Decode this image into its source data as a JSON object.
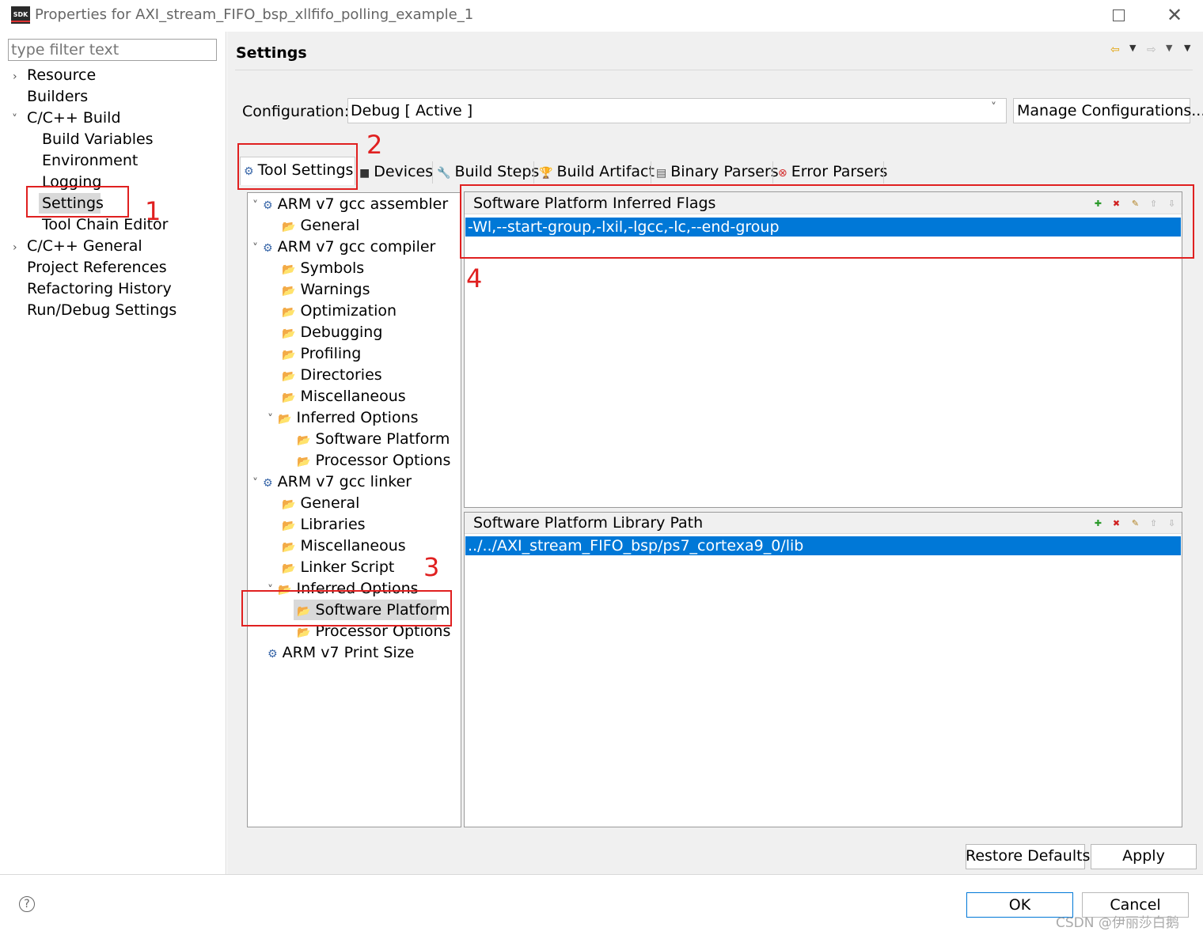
{
  "window": {
    "title": "Properties for AXI_stream_FIFO_bsp_xllfifo_polling_example_1",
    "icon_label": "SDK"
  },
  "filter": {
    "placeholder": "type filter text"
  },
  "left_nav": {
    "items": [
      {
        "label": "Resource",
        "chevron": "›"
      },
      {
        "label": "Builders"
      },
      {
        "label": "C/C++ Build",
        "chevron": "˅"
      },
      {
        "label": "Build Variables"
      },
      {
        "label": "Environment"
      },
      {
        "label": "Logging"
      },
      {
        "label": "Settings"
      },
      {
        "label": "Tool Chain Editor"
      },
      {
        "label": "C/C++ General",
        "chevron": "›"
      },
      {
        "label": "Project References"
      },
      {
        "label": "Refactoring History"
      },
      {
        "label": "Run/Debug Settings"
      }
    ]
  },
  "header": {
    "title": "Settings"
  },
  "config": {
    "label": "Configuration:",
    "value": "Debug  [ Active ]",
    "manage_label": "Manage Configurations..."
  },
  "tabs": [
    {
      "label": "Tool Settings",
      "icon": "gear-icon"
    },
    {
      "label": "Devices",
      "icon": "chip-icon"
    },
    {
      "label": "Build Steps",
      "icon": "wrench-icon"
    },
    {
      "label": "Build Artifact",
      "icon": "trophy-icon"
    },
    {
      "label": "Binary Parsers",
      "icon": "binary-icon"
    },
    {
      "label": "Error Parsers",
      "icon": "error-icon"
    }
  ],
  "tool_tree": [
    {
      "label": "ARM v7 gcc assembler"
    },
    {
      "label": "General"
    },
    {
      "label": "ARM v7 gcc compiler"
    },
    {
      "label": "Symbols"
    },
    {
      "label": "Warnings"
    },
    {
      "label": "Optimization"
    },
    {
      "label": "Debugging"
    },
    {
      "label": "Profiling"
    },
    {
      "label": "Directories"
    },
    {
      "label": "Miscellaneous"
    },
    {
      "label": "Inferred Options"
    },
    {
      "label": "Software Platform"
    },
    {
      "label": "Processor Options"
    },
    {
      "label": "ARM v7 gcc linker"
    },
    {
      "label": "General"
    },
    {
      "label": "Libraries"
    },
    {
      "label": "Miscellaneous"
    },
    {
      "label": "Linker Script"
    },
    {
      "label": "Inferred Options"
    },
    {
      "label": "Software Platform"
    },
    {
      "label": "Processor Options"
    },
    {
      "label": "ARM v7 Print Size"
    }
  ],
  "panel_flags": {
    "title": "Software Platform Inferred Flags",
    "value": "-Wl,--start-group,-lxil,-lgcc,-lc,--end-group"
  },
  "panel_libpath": {
    "title": "Software Platform Library Path",
    "value": "../../AXI_stream_FIFO_bsp/ps7_cortexa9_0/lib"
  },
  "buttons": {
    "restore": "Restore Defaults",
    "apply": "Apply",
    "ok": "OK",
    "cancel": "Cancel"
  },
  "annotations": {
    "n1": "1",
    "n2": "2",
    "n3": "3",
    "n4": "4"
  },
  "help": "?",
  "watermark": "CSDN @伊丽莎白鹅",
  "colors": {
    "selection": "#0078d7",
    "annotation": "#e02020"
  }
}
